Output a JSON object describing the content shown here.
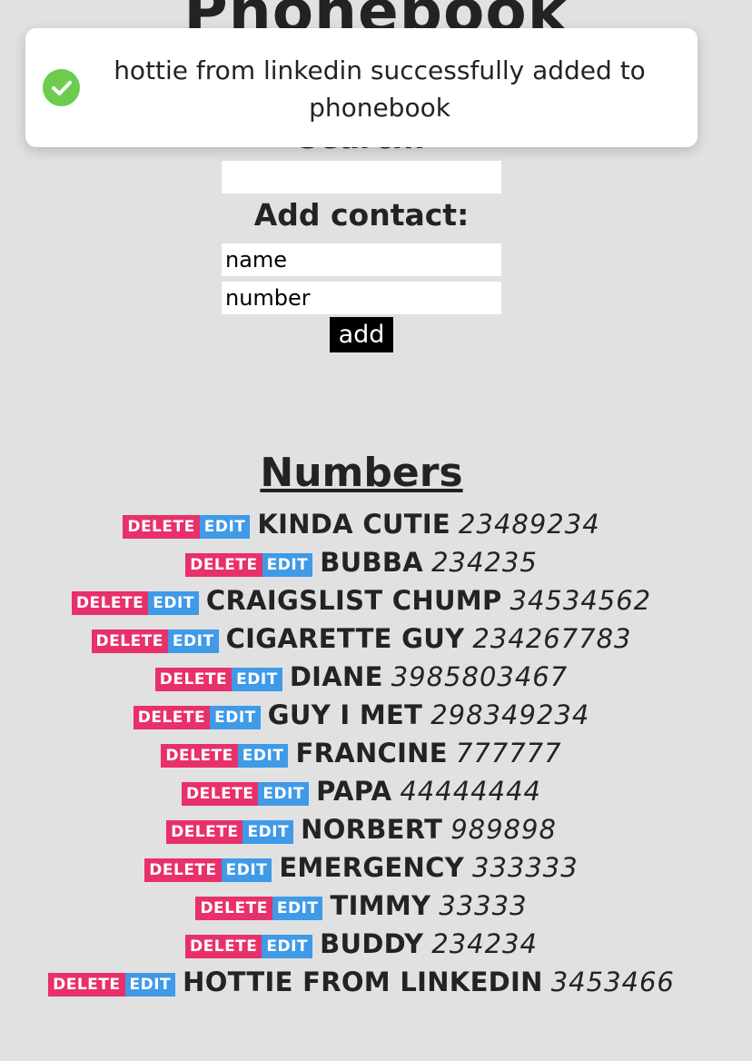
{
  "page": {
    "title": "Phonebook"
  },
  "search": {
    "label": "Search:",
    "value": ""
  },
  "add_contact": {
    "label": "Add contact:",
    "name_placeholder": "name",
    "number_placeholder": "number",
    "add_label": "add"
  },
  "numbers": {
    "title": "Numbers",
    "delete_label": "DELETE",
    "edit_label": "EDIT",
    "contacts": [
      {
        "name": "Kinda cutie",
        "number": "23489234"
      },
      {
        "name": "Bubba",
        "number": "234235"
      },
      {
        "name": "Craigslist chump",
        "number": "34534562"
      },
      {
        "name": "Cigarette guy",
        "number": "234267783"
      },
      {
        "name": "Diane",
        "number": "3985803467"
      },
      {
        "name": "Guy I met",
        "number": "298349234"
      },
      {
        "name": "Francine",
        "number": "777777"
      },
      {
        "name": "Papa",
        "number": "44444444"
      },
      {
        "name": "Norbert",
        "number": "989898"
      },
      {
        "name": "Emergency",
        "number": "333333"
      },
      {
        "name": "Timmy",
        "number": "33333"
      },
      {
        "name": "Buddy",
        "number": "234234"
      },
      {
        "name": "hottie from linkedin",
        "number": "3453466"
      }
    ]
  },
  "notification": {
    "message": "hottie from linkedin successfully added to phonebook",
    "icon": "check-circle-icon",
    "icon_color": "#6ccc4e"
  },
  "colors": {
    "background": "#e1e1e1",
    "delete_button": "#e8306a",
    "edit_button": "#3f9ae8",
    "add_button": "#000000"
  }
}
